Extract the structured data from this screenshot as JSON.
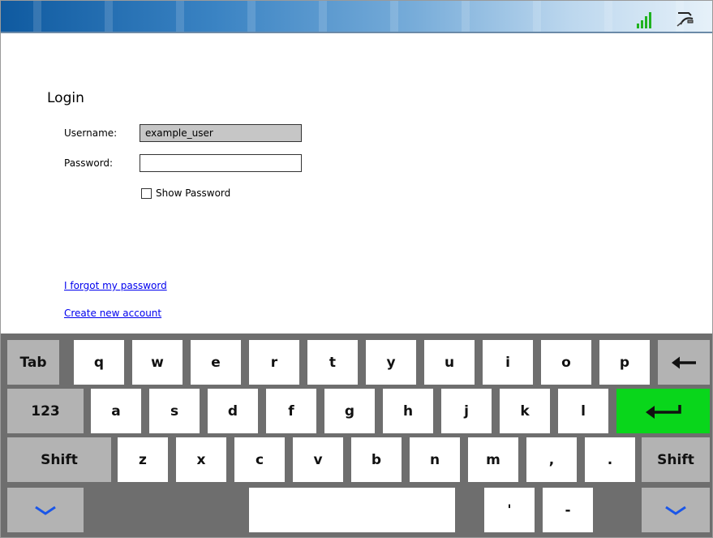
{
  "login": {
    "title": "Login",
    "username_label": "Username:",
    "username_value": "example_user",
    "password_label": "Password:",
    "password_value": "",
    "show_password_label": "Show Password",
    "show_password_checked": false,
    "forgot_link": "I forgot my password",
    "create_link": "Create new account"
  },
  "colors": {
    "signal": "#1fb21f",
    "enter_key": "#09d61b",
    "key_gray": "#b3b3b3",
    "keyboard_bg": "#6e6e6e",
    "chevron": "#1a56e8"
  },
  "keyboard": {
    "tab": "Tab",
    "row1": [
      "q",
      "w",
      "e",
      "r",
      "t",
      "y",
      "u",
      "i",
      "o",
      "p"
    ],
    "num": "123",
    "row2": [
      "a",
      "s",
      "d",
      "f",
      "g",
      "h",
      "j",
      "k",
      "l"
    ],
    "shift": "Shift",
    "row3": [
      "z",
      "x",
      "c",
      "v",
      "b",
      "n",
      "m",
      ",",
      "."
    ],
    "row4": [
      "'",
      "-"
    ],
    "icons": {
      "backspace": "backspace-arrow-icon",
      "enter": "enter-arrow-icon",
      "hide": "chevron-down-icon",
      "signal": "signal-strength-icon",
      "connection": "connection-plug-icon"
    }
  }
}
